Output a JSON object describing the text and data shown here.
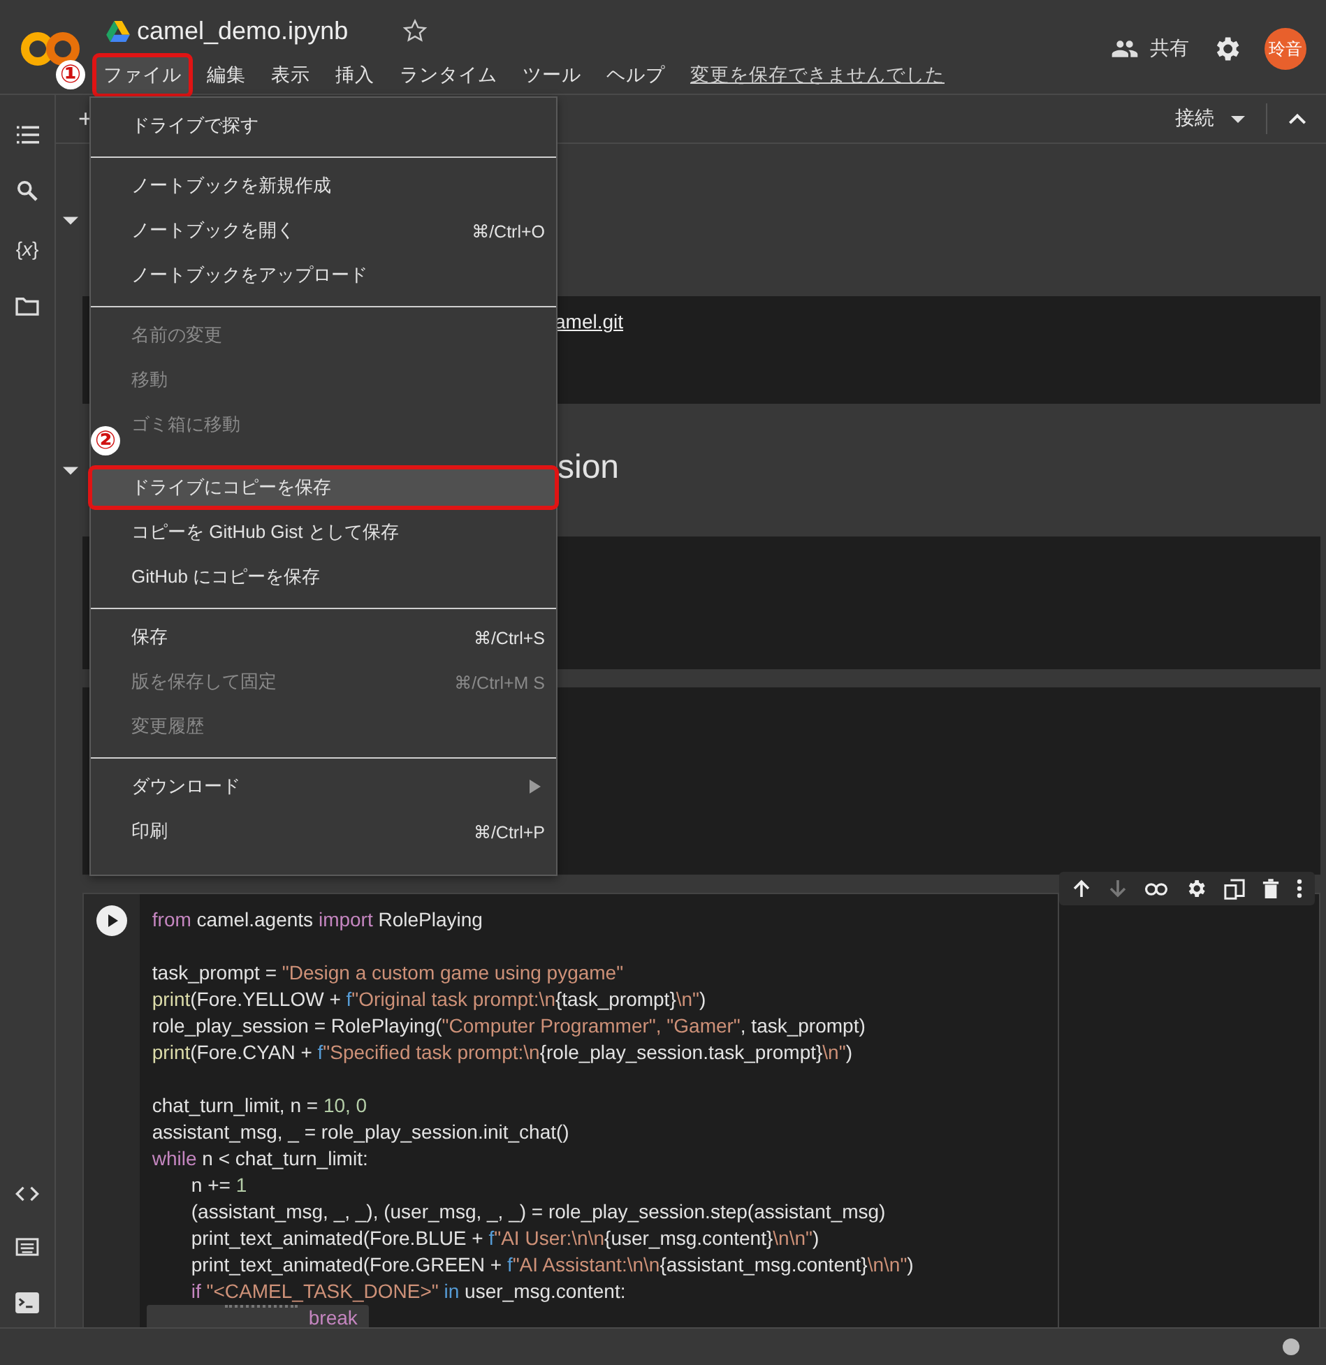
{
  "header": {
    "notebook_title": "camel_demo.ipynb",
    "starred": false,
    "share_label": "共有",
    "avatar": "玲音"
  },
  "menubar": [
    {
      "label": "ファイル",
      "selected": true,
      "callout": "①"
    },
    {
      "label": "編集",
      "selected": false
    },
    {
      "label": "表示",
      "selected": false
    },
    {
      "label": "挿入",
      "selected": false
    },
    {
      "label": "ランタイム",
      "selected": false
    },
    {
      "label": "ツール",
      "selected": false
    },
    {
      "label": "ヘルプ",
      "selected": false
    }
  ],
  "save_status": "変更を保存できませんでした",
  "sidebar": {
    "variables_label": "{*x*}"
  },
  "toolbar": {
    "add_label": "+",
    "connect_label": "接続"
  },
  "cells": [
    {
      "kind": "section"
    },
    {
      "kind": "code",
      "text": "amel.git"
    },
    {
      "kind": "section",
      "text": "sion"
    },
    {
      "kind": "code"
    },
    {
      "kind": "code"
    }
  ],
  "code_cell": {
    "blocks": [
      [
        {
          "highlighted": false,
          "tokens": [
            {
              "kind": "keyword",
              "text": "from"
            },
            {
              "kind": "plain",
              "text": " camel.agents "
            },
            {
              "kind": "keyword",
              "text": "import"
            },
            {
              "kind": "plain",
              "text": " RolePlaying"
            }
          ]
        }
      ],
      [
        {
          "highlighted": false,
          "tokens": [
            {
              "kind": "plain",
              "text": "task_prompt = "
            },
            {
              "kind": "string",
              "text": "\"Design a custom game using pygame\""
            }
          ]
        },
        {
          "highlighted": false,
          "tokens": [
            {
              "kind": "builtin",
              "text": "print"
            },
            {
              "kind": "plain",
              "text": "(Fore.YELLOW + "
            },
            {
              "kind": "prefix",
              "text": "f"
            },
            {
              "kind": "string",
              "text": "\"Original task prompt:\\n"
            },
            {
              "kind": "plain",
              "text": "{task_prompt}"
            },
            {
              "kind": "string",
              "text": "\\n\""
            },
            {
              "kind": "plain",
              "text": ")"
            }
          ]
        },
        {
          "highlighted": false,
          "tokens": [
            {
              "kind": "plain",
              "text": "role_play_session = RolePlaying("
            },
            {
              "kind": "string",
              "text": "\"Computer Programmer\""
            },
            {
              "kind": "string",
              "text": ", \"Gamer\""
            },
            {
              "kind": "plain",
              "text": ", task_prompt)"
            }
          ]
        },
        {
          "highlighted": false,
          "tokens": [
            {
              "kind": "builtin",
              "text": "print"
            },
            {
              "kind": "plain",
              "text": "(Fore.CYAN + "
            },
            {
              "kind": "prefix",
              "text": "f"
            },
            {
              "kind": "string",
              "text": "\"Specified task prompt:\\n"
            },
            {
              "kind": "plain",
              "text": "{role_play_session.task_prompt}"
            },
            {
              "kind": "string",
              "text": "\\n\""
            },
            {
              "kind": "plain",
              "text": ")"
            }
          ]
        }
      ],
      [
        {
          "highlighted": false,
          "tokens": [
            {
              "kind": "plain",
              "text": "chat_turn_limit, n = "
            },
            {
              "kind": "number",
              "text": "10"
            },
            {
              "kind": "number",
              "text": ", 0"
            }
          ]
        },
        {
          "highlighted": false,
          "tokens": [
            {
              "kind": "plain",
              "text": "assistant_msg, _ = role_play_session.init_chat()"
            }
          ]
        },
        {
          "highlighted": false,
          "tokens": [
            {
              "kind": "keyword",
              "text": "while"
            },
            {
              "kind": "plain",
              "text": " n < chat_turn_limit:"
            }
          ],
          "children": [
            {
              "highlighted": false,
              "tokens": [
                {
                  "kind": "plain",
                  "text": "n += "
                },
                {
                  "kind": "number",
                  "text": "1"
                }
              ]
            },
            {
              "highlighted": false,
              "tokens": [
                {
                  "kind": "plain",
                  "text": "(assistant_msg, _, _), (user_msg, _, _) = role_play_session.step(assistant_msg)"
                }
              ]
            },
            {
              "highlighted": false,
              "tokens": [
                {
                  "kind": "plain",
                  "text": "print_text_animated(Fore.BLUE + "
                },
                {
                  "kind": "prefix",
                  "text": "f"
                },
                {
                  "kind": "string",
                  "text": "\"AI User:\\n\\n"
                },
                {
                  "kind": "plain",
                  "text": "{user_msg.content}"
                },
                {
                  "kind": "string",
                  "text": "\\n\\n\""
                },
                {
                  "kind": "plain",
                  "text": ")"
                }
              ]
            },
            {
              "highlighted": false,
              "tokens": [
                {
                  "kind": "plain",
                  "text": "print_text_animated(Fore.GREEN + "
                },
                {
                  "kind": "prefix",
                  "text": "f"
                },
                {
                  "kind": "string",
                  "text": "\"AI Assistant:\\n\\n"
                },
                {
                  "kind": "plain",
                  "text": "{assistant_msg.content}"
                },
                {
                  "kind": "string",
                  "text": "\\n\\n\""
                },
                {
                  "kind": "plain",
                  "text": ")"
                }
              ]
            },
            {
              "highlighted": false,
              "tokens": [
                {
                  "kind": "keyword",
                  "text": "if"
                },
                {
                  "kind": "string",
                  "text": " \"<CAMEL_TASK_DONE>\""
                },
                {
                  "kind": "prefix",
                  "text": " in"
                },
                {
                  "kind": "plain",
                  "text": " user_msg.content:"
                }
              ],
              "children": [
                {
                  "highlighted": true,
                  "tokens": [
                    {
                      "kind": "keyword",
                      "text": "break"
                    }
                  ]
                }
              ]
            }
          ]
        }
      ]
    ]
  },
  "file_menu": {
    "sections": [
      [
        {
          "label": "ドライブで探す",
          "disabled": false,
          "selected": false,
          "submenu": false
        }
      ],
      [
        {
          "label": "ノートブックを新規作成",
          "disabled": false,
          "selected": false,
          "submenu": false
        },
        {
          "label": "ノートブックを開く",
          "shortcut": "⌘/Ctrl+O",
          "disabled": false,
          "selected": false,
          "submenu": false
        },
        {
          "label": "ノートブックをアップロード",
          "disabled": false,
          "selected": false,
          "submenu": false
        }
      ],
      [
        {
          "label": "名前の変更",
          "disabled": true,
          "selected": false,
          "submenu": false
        },
        {
          "label": "移動",
          "disabled": true,
          "selected": false,
          "submenu": false
        },
        {
          "label": "ゴミ箱に移動",
          "disabled": true,
          "selected": false,
          "submenu": false
        },
        {
          "label": "ドライブにコピーを保存",
          "disabled": false,
          "selected": true,
          "submenu": false,
          "callout": "②"
        },
        {
          "label": "コピーを GitHub Gist として保存",
          "disabled": false,
          "selected": false,
          "submenu": false
        },
        {
          "label": "GitHub にコピーを保存",
          "disabled": false,
          "selected": false,
          "submenu": false
        }
      ],
      [
        {
          "label": "保存",
          "shortcut": "⌘/Ctrl+S",
          "disabled": false,
          "selected": false,
          "submenu": false
        },
        {
          "label": "版を保存して固定",
          "shortcut": "⌘/Ctrl+M S",
          "disabled": true,
          "selected": false,
          "submenu": false
        },
        {
          "label": "変更履歴",
          "disabled": true,
          "selected": false,
          "submenu": false
        }
      ],
      [
        {
          "label": "ダウンロード",
          "disabled": false,
          "selected": false,
          "submenu": true
        },
        {
          "label": "印刷",
          "shortcut": "⌘/Ctrl+P",
          "disabled": false,
          "selected": false,
          "submenu": false
        }
      ]
    ]
  }
}
